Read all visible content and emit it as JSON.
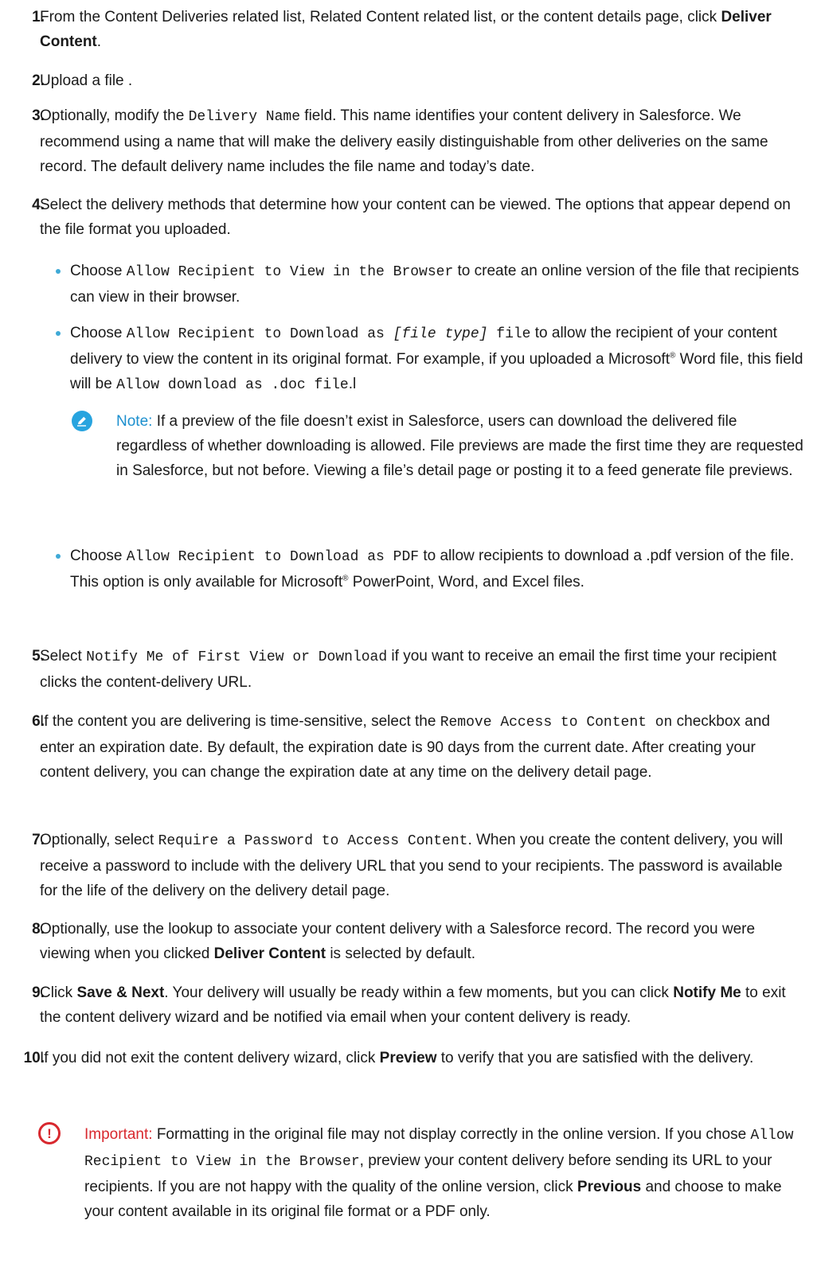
{
  "steps": [
    {
      "num": "1.",
      "parts": [
        {
          "t": "text",
          "v": "From the Content Deliveries related list, Related Content related list, or the content details page, click "
        },
        {
          "t": "bold",
          "v": "Deliver Content"
        },
        {
          "t": "text",
          "v": "."
        }
      ]
    },
    {
      "num": "2.",
      "parts": [
        {
          "t": "text",
          "v": "Upload a file ."
        }
      ]
    },
    {
      "num": "3.",
      "parts": [
        {
          "t": "text",
          "v": "Optionally, modify the "
        },
        {
          "t": "code",
          "v": "Delivery Name"
        },
        {
          "t": "text",
          "v": " field. This name identifies your content delivery in Salesforce. We recommend using a name that will make the delivery easily distinguishable from other deliveries on the same record. The default delivery name includes the file name and today’s date."
        }
      ]
    },
    {
      "num": "4.",
      "parts": [
        {
          "t": "text",
          "v": "Select the delivery methods that determine how your content can be viewed. The options that appear depend on the file format you uploaded."
        }
      ]
    },
    {
      "num": "5.",
      "parts": [
        {
          "t": "text",
          "v": "Select "
        },
        {
          "t": "code",
          "v": "Notify Me of First View or Download"
        },
        {
          "t": "text",
          "v": " if you want to receive an email the first time your recipient clicks the content-delivery URL."
        }
      ]
    },
    {
      "num": "6.",
      "parts": [
        {
          "t": "text",
          "v": "If the content you are delivering is time-sensitive, select the "
        },
        {
          "t": "code",
          "v": "Remove Access to Content on"
        },
        {
          "t": "text",
          "v": " checkbox and enter an expiration date. By default, the expiration date is 90 days from the current date. After creating your content delivery, you can change the expiration date at any time on the delivery detail page."
        }
      ]
    },
    {
      "num": "7.",
      "parts": [
        {
          "t": "text",
          "v": "Optionally, select "
        },
        {
          "t": "code",
          "v": "Require a Password to Access Content"
        },
        {
          "t": "text",
          "v": ". When you create the content delivery, you will receive a password to include with the delivery URL that you send to your recipients. The password is available for the life of the delivery on the delivery detail page."
        }
      ]
    },
    {
      "num": "8.",
      "parts": [
        {
          "t": "text",
          "v": "Optionally, use the lookup to associate your content delivery with a Salesforce record. The record you were viewing when you clicked "
        },
        {
          "t": "bold",
          "v": "Deliver Content"
        },
        {
          "t": "text",
          "v": " is selected by default."
        }
      ]
    },
    {
      "num": "9.",
      "parts": [
        {
          "t": "text",
          "v": "Click "
        },
        {
          "t": "bold",
          "v": "Save & Next"
        },
        {
          "t": "text",
          "v": ". Your delivery will usually be ready within a few moments, but you can click "
        },
        {
          "t": "bold",
          "v": "Notify Me"
        },
        {
          "t": "text",
          "v": " to exit the content delivery wizard and be notified via email when your content delivery is ready."
        }
      ]
    },
    {
      "num": "10.",
      "parts": [
        {
          "t": "text",
          "v": "If you did not exit the content delivery wizard, click "
        },
        {
          "t": "bold",
          "v": "Preview"
        },
        {
          "t": "text",
          "v": " to verify that you are satisfied with the delivery."
        }
      ]
    }
  ],
  "bullets": [
    {
      "parts": [
        {
          "t": "text",
          "v": "Choose "
        },
        {
          "t": "code",
          "v": "Allow Recipient to View in the Browser"
        },
        {
          "t": "text",
          "v": " to create an online version of the file that recipients can view in their browser."
        }
      ]
    },
    {
      "parts": [
        {
          "t": "text",
          "v": "Choose "
        },
        {
          "t": "code",
          "v": "Allow Recipient to Download as "
        },
        {
          "t": "codeitalic",
          "v": "[file type]"
        },
        {
          "t": "code",
          "v": " file"
        },
        {
          "t": "text",
          "v": " to allow the recipient of your content delivery to view the content in its original format. For example, if you uploaded a Microsoft"
        },
        {
          "t": "sup",
          "v": "®"
        },
        {
          "t": "text",
          "v": " Word file, this field will be "
        },
        {
          "t": "code",
          "v": "Allow download as .doc file"
        },
        {
          "t": "text",
          "v": ".l"
        }
      ]
    },
    {
      "parts": [
        {
          "t": "text",
          "v": "Choose "
        },
        {
          "t": "code",
          "v": "Allow Recipient to Download as PDF"
        },
        {
          "t": "text",
          "v": " to allow recipients to download a .pdf version of the file. This option is only available for Microsoft"
        },
        {
          "t": "sup",
          "v": "®"
        },
        {
          "t": "text",
          "v": " PowerPoint, Word, and Excel files."
        }
      ]
    }
  ],
  "note": {
    "label": "Note:",
    "parts": [
      {
        "t": "text",
        "v": "If a preview of the file doesn’t exist in Salesforce, users can download the delivered file regardless of whether downloading is allowed. File previews are made the first time they are requested in Salesforce, but not before. Viewing a file’s detail page or posting it to a feed generate file previews."
      }
    ]
  },
  "important": {
    "label": "Important:",
    "icon_glyph": "!",
    "parts": [
      {
        "t": "text",
        "v": "Formatting in the original file may not display correctly in the online version. If you chose "
      },
      {
        "t": "code",
        "v": "Allow Recipient to View in the Browser"
      },
      {
        "t": "text",
        "v": ", preview your content delivery before sending its URL to your recipients. If you are not happy with the quality of the online version, click "
      },
      {
        "t": "bold",
        "v": "Previous"
      },
      {
        "t": "text",
        "v": " and choose to make your content available in its original file format or a PDF only."
      }
    ]
  },
  "colors": {
    "note_blue": "#1b8fce",
    "important_red": "#d8282e",
    "bullet_blue": "#3fa9d6"
  }
}
